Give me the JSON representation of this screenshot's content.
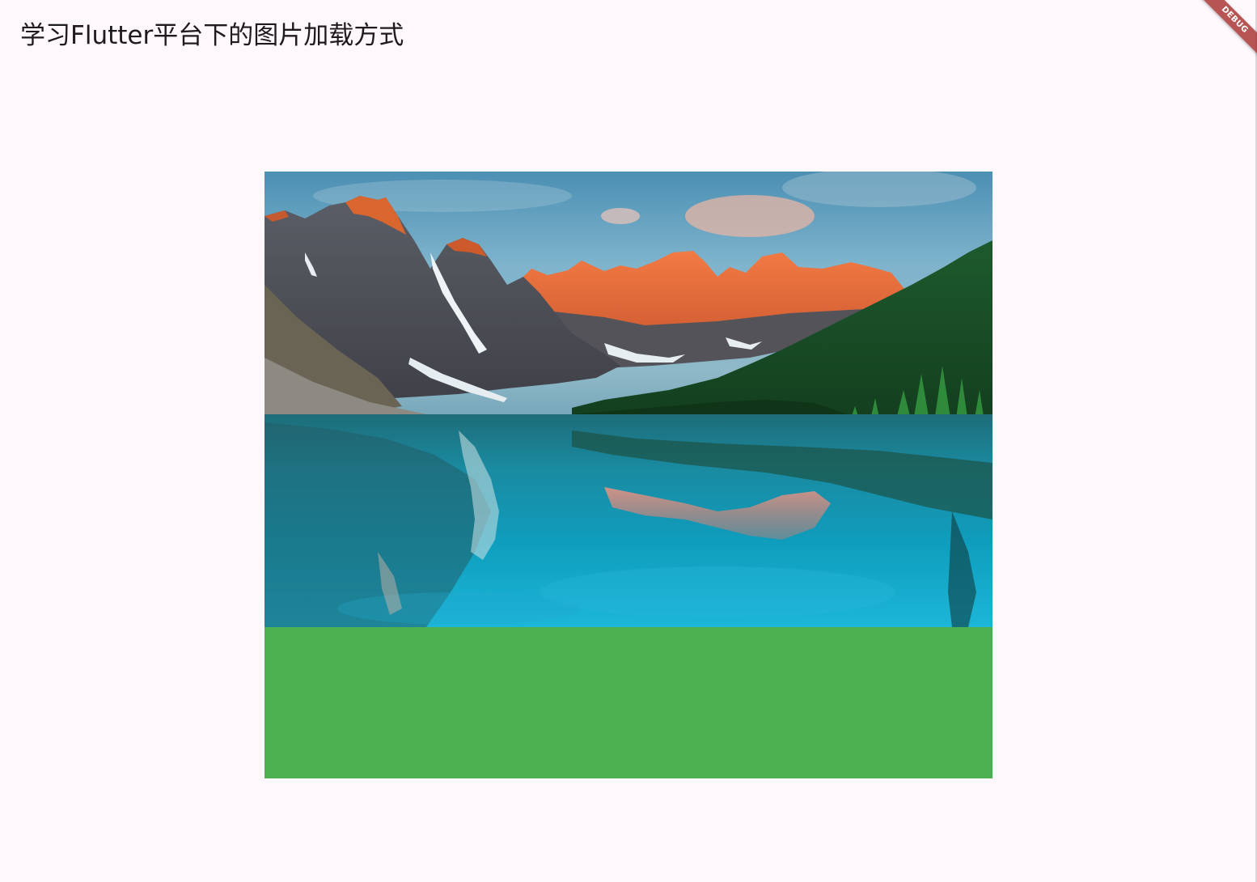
{
  "app_bar": {
    "title": "学习Flutter平台下的图片加载方式"
  },
  "content": {
    "image_description": "mountain lake landscape with forest and reflections",
    "container_color": "#4caf50",
    "background_color": "#fef7fb"
  },
  "debug_banner": {
    "label": "DEBUG",
    "color": "#a52a2a"
  }
}
